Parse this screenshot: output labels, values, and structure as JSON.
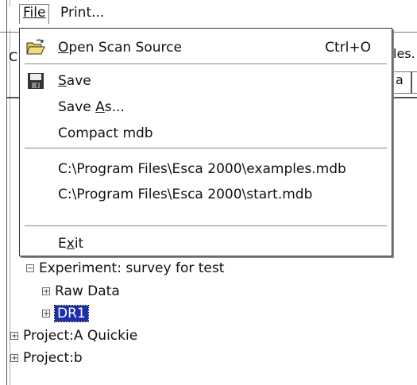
{
  "menubar": {
    "file_label": "File",
    "print_label": "Print..."
  },
  "background": {
    "right_partial_text": "les.",
    "left_partial_text": "C",
    "tab_partial_text": "a"
  },
  "tree": {
    "experiment_label": "Experiment: survey for test",
    "raw_data_label": "Raw Data",
    "dr1_label": "DR1",
    "project_a_label": "Project:A Quickie",
    "project_b_label": "Project:b"
  },
  "file_menu": {
    "open_scan_source": {
      "pre": "",
      "u": "O",
      "post": "pen Scan Source",
      "shortcut": "Ctrl+O",
      "icon": "open-folder-icon"
    },
    "save": {
      "pre": "",
      "u": "S",
      "post": "ave",
      "icon": "floppy-disk-icon"
    },
    "save_as": {
      "pre": "Save ",
      "u": "A",
      "post": "s..."
    },
    "compact_mdb": "Compact mdb",
    "recent_1": "C:\\Program Files\\Esca 2000\\examples.mdb",
    "recent_2": "C:\\Program Files\\Esca 2000\\start.mdb",
    "exit": {
      "pre": "E",
      "u": "x",
      "post": "it"
    }
  }
}
